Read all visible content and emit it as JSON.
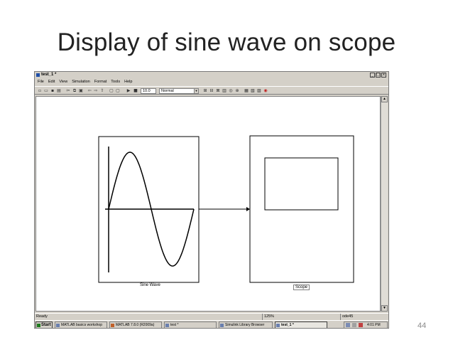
{
  "slide": {
    "title": "Display of sine wave on scope",
    "page_number": "44"
  },
  "window": {
    "title": "test_1 *",
    "buttons": [
      "_",
      "□",
      "x"
    ]
  },
  "menu": [
    "File",
    "Edit",
    "View",
    "Simulation",
    "Format",
    "Tools",
    "Help"
  ],
  "toolbar": {
    "stop_time": "10.0",
    "sim_mode": "Normal",
    "icons": [
      "new-icon",
      "open-icon",
      "save-icon",
      "print-icon",
      "cut-icon",
      "copy-icon",
      "paste-icon",
      "undo-icon",
      "redo-icon",
      "up-icon",
      "comment-icon",
      "uncomment-icon",
      "play-icon",
      "stop-icon",
      "build-icon",
      "library-icon",
      "model-explorer-icon",
      "debug-icon",
      "help-icon",
      "zoom-icon",
      "profiler-icon",
      "sync-icon",
      "record-icon",
      "target-icon"
    ]
  },
  "blocks": {
    "sine_wave": "Sine Wave",
    "scope": "Scope"
  },
  "status": {
    "ready": "Ready",
    "zoom": "125%",
    "solver": "ode45"
  },
  "taskbar": {
    "start": "Start",
    "items": [
      "MATLAB basics workshop",
      "MATLAB 7.8.0 (R2009a)",
      "test *",
      "Simulink Library Browser",
      "test_1 *"
    ],
    "time": "4:01 PM"
  }
}
